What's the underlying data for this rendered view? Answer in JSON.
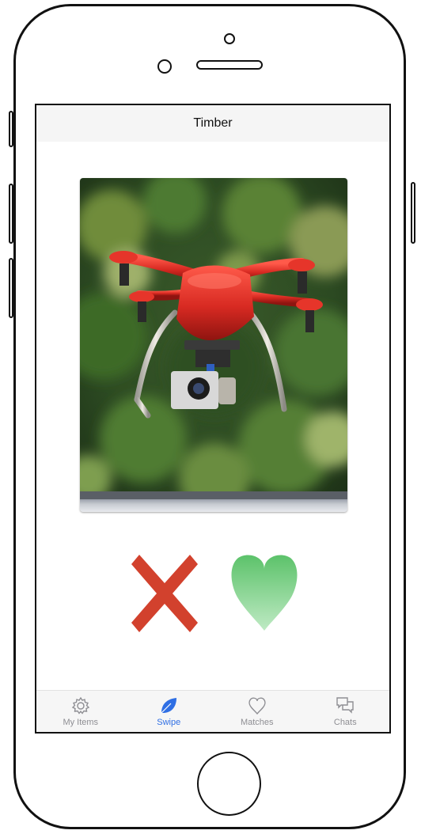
{
  "app": {
    "title": "Timber"
  },
  "card": {
    "image_icon": "drone-photo",
    "colors": {
      "drone": "#d82a22",
      "foliage": "#3f6a2c"
    }
  },
  "actions": {
    "reject_icon": "x-icon",
    "like_icon": "heart-icon",
    "colors": {
      "reject": "#d2412d",
      "like_top": "#5cc26a",
      "like_bottom": "#bfeac4"
    }
  },
  "tabbar": {
    "active": "Swipe",
    "active_color": "#2f6fe4",
    "inactive_color": "#8e8e93",
    "items": [
      {
        "label": "My Items",
        "icon": "gear-icon"
      },
      {
        "label": "Swipe",
        "icon": "leaf-icon"
      },
      {
        "label": "Matches",
        "icon": "heart-outline-icon"
      },
      {
        "label": "Chats",
        "icon": "chat-bubbles-icon"
      }
    ]
  }
}
